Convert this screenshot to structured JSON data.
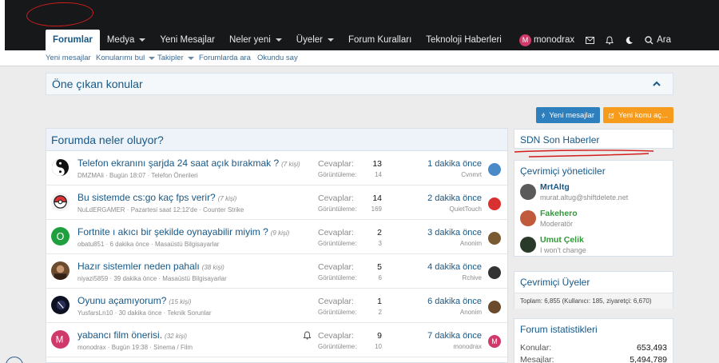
{
  "nav": {
    "items": [
      {
        "label": "Forumlar",
        "active": true,
        "dropdown": false
      },
      {
        "label": "Medya",
        "active": false,
        "dropdown": true
      },
      {
        "label": "Yeni Mesajlar",
        "active": false,
        "dropdown": false
      },
      {
        "label": "Neler yeni",
        "active": false,
        "dropdown": true
      },
      {
        "label": "Üyeler",
        "active": false,
        "dropdown": true
      },
      {
        "label": "Forum Kuralları",
        "active": false,
        "dropdown": false
      },
      {
        "label": "Teknoloji Haberleri",
        "active": false,
        "dropdown": false
      }
    ],
    "user": {
      "initial": "M",
      "name": "monodrax"
    },
    "search_label": "Ara",
    "icons": [
      "inbox-icon",
      "bell-icon",
      "moon-icon",
      "search-icon"
    ]
  },
  "subnav": {
    "items": [
      {
        "label": "Yeni mesajlar",
        "dropdown": false
      },
      {
        "label": "Konularımı bul",
        "dropdown": true
      },
      {
        "label": "Takipler",
        "dropdown": true
      },
      {
        "label": "Forumlarda ara",
        "dropdown": false
      },
      {
        "label": "Okundu say",
        "dropdown": false
      }
    ]
  },
  "featured": {
    "title": "Öne çıkan konular",
    "icon": "chevron-up-icon"
  },
  "buttons": {
    "new_messages": "Yeni mesajlar",
    "new_topic": "Yeni konu aç..."
  },
  "main": {
    "title": "Forumda neler oluyor?",
    "labels": {
      "replies": "Cevaplar:",
      "views": "Görüntüleme:"
    },
    "threads": [
      {
        "title": "Telefon ekranını şarjda 24 saat açık bırakmak ?",
        "kisi": "(7 kişi)",
        "author": "DMZMAli",
        "date": "Bugün 18:07",
        "forum": "Telefon Önerileri",
        "replies": "13",
        "views": "14",
        "last_time": "1 dakika önce",
        "last_user": "Cvnmrt",
        "avatar": "yinyang",
        "watched": false
      },
      {
        "title": "Bu sistemde cs:go kaç fps verir?",
        "kisi": "(7 kişi)",
        "author": "NuLdERGAMER",
        "date": "Pazartesi saat 12:12'de",
        "forum": "Counter Strike",
        "replies": "14",
        "views": "169",
        "last_time": "2 dakika önce",
        "last_user": "QuietTouch",
        "avatar": "pokeball",
        "watched": false
      },
      {
        "title": "Fortnite ı akıcı bir şekilde oynayabilir miyim ?",
        "kisi": "(9 kişi)",
        "author": "obatu851",
        "date": "6 dakika önce",
        "forum": "Masaüstü Bilgisayarlar",
        "replies": "2",
        "views": "3",
        "last_time": "3 dakika önce",
        "last_user": "Anonim",
        "avatar": "letter-o",
        "avatar_letter": "O",
        "watched": false
      },
      {
        "title": "Hazır sistemler neden pahalı",
        "kisi": "(38 kişi)",
        "author": "niyazi5859",
        "date": "39 dakika önce",
        "forum": "Masaüstü Bilgisayarlar",
        "replies": "5",
        "views": "6",
        "last_time": "4 dakika önce",
        "last_user": "Rchive",
        "avatar": "photo",
        "watched": false
      },
      {
        "title": "Oyunu açamıyorum?",
        "kisi": "(15 kişi)",
        "author": "YusfarsLn10",
        "date": "30 dakika önce",
        "forum": "Teknik Sorunlar",
        "replies": "1",
        "views": "2",
        "last_time": "6 dakika önce",
        "last_user": "Anonim",
        "avatar": "dark",
        "watched": false
      },
      {
        "title": "yabancı film önerisi.",
        "kisi": "(32 kişi)",
        "author": "monodrax",
        "date": "Bugün 19:38",
        "forum": "Sinema / Film",
        "replies": "9",
        "views": "10",
        "last_time": "7 dakika önce",
        "last_user": "monodrax",
        "avatar": "letter-m",
        "avatar_letter": "M",
        "watched": true
      }
    ]
  },
  "sidebar": {
    "news_title": "SDN Son Haberler",
    "mods_title": "Çevrimiçi yöneticiler",
    "mods": [
      {
        "name": "MrtAltg",
        "role": "murat.altug@shiftdelete.net",
        "color": "#185886"
      },
      {
        "name": "Fakehero",
        "role": "Moderatör",
        "color": "#2f9a37"
      },
      {
        "name": "Umut Çelik",
        "role": "I won't change",
        "color": "#2f9a37"
      }
    ],
    "online_title": "Çevrimiçi Üyeler",
    "online_stats": "Toplam: 6,855 (Kullanıcı: 185, ziyaretçi: 6,670)",
    "stats_title": "Forum istatistikleri",
    "stats": [
      {
        "label": "Konular:",
        "value": "653,493"
      },
      {
        "label": "Mesajlar:",
        "value": "5,494,789"
      }
    ]
  },
  "colors": {
    "accent": "#185886",
    "topbar": "#17181a",
    "button_blue": "#2d7fbd",
    "button_orange": "#f79b1d",
    "annotation_red": "#d41c1c"
  }
}
